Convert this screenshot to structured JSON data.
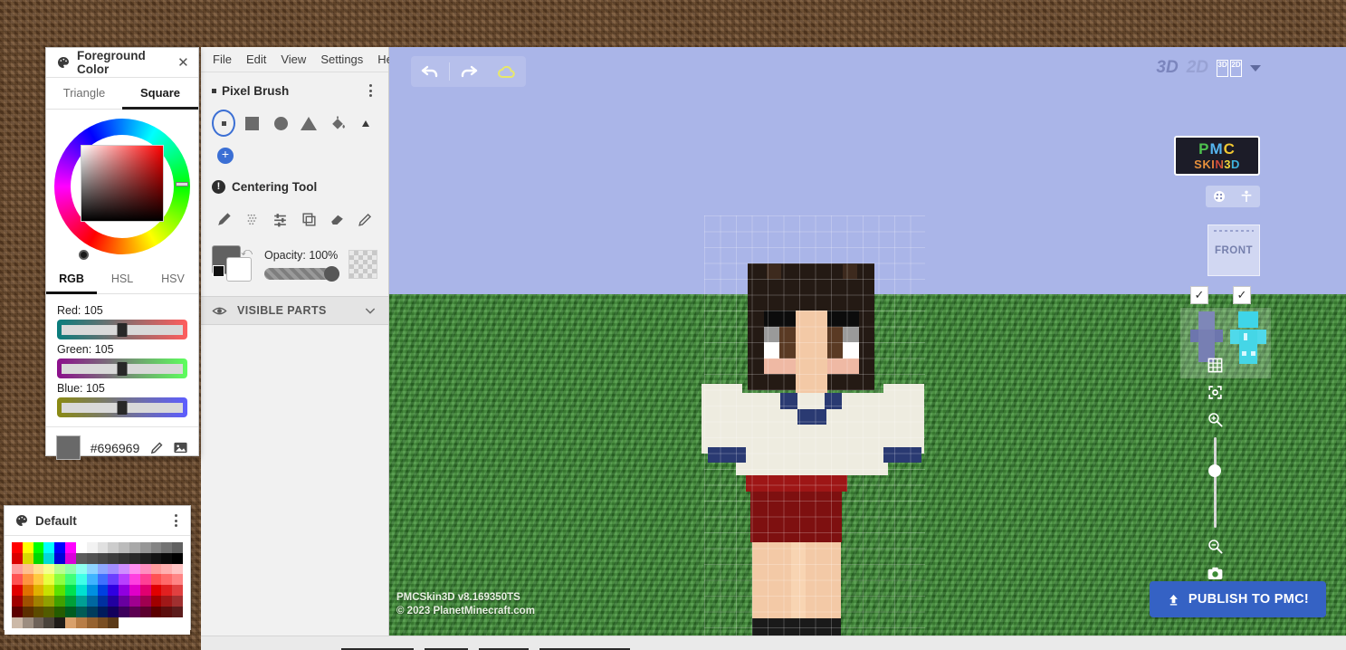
{
  "app": {
    "watermark_line1": "PMCSkin3D v8.169350TS",
    "watermark_line2": "© 2023 PlanetMinecraft.com",
    "logo_top": "PMC",
    "logo_bottom": "SKIN3D"
  },
  "menubar": {
    "items": [
      {
        "label": "File"
      },
      {
        "label": "Edit"
      },
      {
        "label": "View"
      },
      {
        "label": "Settings"
      },
      {
        "label": "Help"
      }
    ]
  },
  "foreground_color_panel": {
    "title": "Foreground Color",
    "icon": "palette-icon",
    "close_label": "✕",
    "shape_tabs": [
      {
        "label": "Triangle",
        "selected": false
      },
      {
        "label": "Square",
        "selected": true
      }
    ],
    "mode_tabs": [
      {
        "label": "RGB",
        "selected": true
      },
      {
        "label": "HSL",
        "selected": false
      },
      {
        "label": "HSV",
        "selected": false
      }
    ],
    "channels": [
      {
        "name": "Red",
        "label": "Red: 105",
        "value": 105
      },
      {
        "name": "Green",
        "label": "Green: 105",
        "value": 105
      },
      {
        "name": "Blue",
        "label": "Blue: 105",
        "value": 105
      }
    ],
    "hex": "#696969",
    "current_color": "#696969",
    "eyedropper_icon": "eyedropper-icon",
    "image_picker_icon": "image-icon"
  },
  "palette_panel": {
    "title": "Default",
    "icon": "palette-icon",
    "rows": [
      [
        "#ff0000",
        "#ffff00",
        "#00ff00",
        "#00ffff",
        "#0000ff",
        "#ff00ff",
        "#ffffff",
        "#f2f2f2",
        "#e0e0e0",
        "#cccccc",
        "#bbbbbb",
        "#a8a8a8",
        "#969696",
        "#848484",
        "#737373",
        "#616161"
      ],
      [
        "#d90000",
        "#d9d900",
        "#00d900",
        "#00d9d9",
        "#0000d9",
        "#d900d9",
        "#5c5c5c",
        "#525252",
        "#474747",
        "#3d3d3d",
        "#333333",
        "#292929",
        "#1f1f1f",
        "#141414",
        "#0a0a0a",
        "#000000"
      ],
      [
        "#ff9e9e",
        "#ffbf8f",
        "#ffe08f",
        "#f5ff8f",
        "#b8ff8f",
        "#8fffab",
        "#8ffff0",
        "#8fd4ff",
        "#8fa8ff",
        "#a38fff",
        "#cf8fff",
        "#ff8ff0",
        "#ff8fc0",
        "#ff9e9e",
        "#ffb0b0",
        "#ffc4c4"
      ],
      [
        "#ff5252",
        "#ff9440",
        "#ffc940",
        "#e8ff40",
        "#8cff40",
        "#40ff7a",
        "#40ffe8",
        "#40b4ff",
        "#4070ff",
        "#6b40ff",
        "#b840ff",
        "#ff40e0",
        "#ff4095",
        "#ff5252",
        "#ff6b6b",
        "#ff8585"
      ],
      [
        "#e00000",
        "#e07000",
        "#e0b000",
        "#c8e000",
        "#5ce000",
        "#00e050",
        "#00e0d0",
        "#0090e0",
        "#0040e0",
        "#3000e0",
        "#9000e0",
        "#e000c8",
        "#e00070",
        "#e00000",
        "#e02020",
        "#e04040"
      ],
      [
        "#a00000",
        "#a05000",
        "#a08000",
        "#90a000",
        "#40a000",
        "#00a038",
        "#00a095",
        "#0068a0",
        "#0030a0",
        "#2200a0",
        "#6800a0",
        "#a00090",
        "#a00050",
        "#a00000",
        "#a01818",
        "#a03030"
      ],
      [
        "#5c0000",
        "#5c2e00",
        "#5c4a00",
        "#525c00",
        "#255c00",
        "#005c20",
        "#005c56",
        "#003c5c",
        "#001b5c",
        "#13005c",
        "#3c005c",
        "#5c0052",
        "#5c002e",
        "#5c0000",
        "#5c0e0e",
        "#5c1c1c"
      ],
      [
        "#ccb9a8",
        "#9c8d80",
        "#6e6259",
        "#4a433c",
        "#1f1c19",
        "#d9a06b",
        "#b87d46",
        "#96622f",
        "#7a4e22",
        "#5c3a18",
        "#ffffff",
        "#ffffff",
        "#ffffff",
        "#ffffff",
        "#ffffff",
        "#ffffff"
      ]
    ]
  },
  "tools_panel": {
    "brush_section": {
      "name": "Pixel Brush",
      "shapes": [
        {
          "name": "dot-brush",
          "selected": true
        },
        {
          "name": "square-brush",
          "selected": false
        },
        {
          "name": "circle-brush",
          "selected": false
        },
        {
          "name": "triangle-brush",
          "selected": false
        },
        {
          "name": "fill-bucket",
          "selected": false
        },
        {
          "name": "tiny-brush",
          "selected": false
        }
      ],
      "add_label": "+",
      "kebab": "more-options-icon"
    },
    "centering_section": {
      "name": "Centering Tool",
      "warn_glyph": "!",
      "tools": [
        {
          "name": "pencil-tool"
        },
        {
          "name": "dither-tool"
        },
        {
          "name": "adjust-tool"
        },
        {
          "name": "layers-tool"
        },
        {
          "name": "eraser-tool"
        },
        {
          "name": "eyedropper-tool"
        }
      ]
    },
    "opacity": {
      "label": "Opacity: 100%",
      "value": 100,
      "foreground_swatch": "#616161",
      "background_swatch": "#ffffff"
    },
    "visible_parts": {
      "label": "VISIBLE PARTS",
      "eye_icon": "eye-icon",
      "chevron": "chevron-down-icon"
    }
  },
  "viewport": {
    "toolbar": [
      {
        "name": "undo-button",
        "glyph": "↶"
      },
      {
        "name": "redo-button",
        "glyph": "↷"
      },
      {
        "name": "cloud-save-button",
        "glyph": "☁"
      }
    ],
    "view_modes": {
      "three_d": "3D",
      "two_d": "2D",
      "split_left": "3D",
      "split_right": "2D"
    },
    "avatar_tools": [
      {
        "name": "skin-preview-icon"
      },
      {
        "name": "pose-icon"
      }
    ],
    "orientation_label": "FRONT",
    "layer_checkboxes": [
      {
        "name": "base-layer-checkbox",
        "checked": true,
        "glyph": "✓"
      },
      {
        "name": "overlay-layer-checkbox",
        "checked": true,
        "glyph": "✓"
      }
    ],
    "right_tools": [
      {
        "name": "grid-toggle-icon"
      },
      {
        "name": "center-view-icon"
      },
      {
        "name": "zoom-in-icon"
      },
      {
        "name": "zoom-out-icon"
      },
      {
        "name": "screenshot-icon"
      }
    ],
    "zoom_slider_value": 68,
    "publish_button": "PUBLISH TO PMC!",
    "publish_icon": "upload-icon",
    "sky_color": "#aab5e8",
    "ground_color": "#3d8b36"
  },
  "character": {
    "description": "Minecraft skin preview: dark-haired character in white sailor uniform with navy collar trim, dark red skirt, bare legs and black shoes",
    "colors": {
      "hair": "#241a14",
      "hair_light": "#3d2a1e",
      "skin": "#f3c9a6",
      "eye_white": "#ffffff",
      "eye_gray": "#9a9a9a",
      "eye_brown": "#5a3a24",
      "blush": "#efb9a4",
      "shirt": "#eeece0",
      "collar": "#2a3a72",
      "skirt": "#9e1616",
      "skirt_dark": "#7e1010",
      "shoes": "#1a1a1a"
    }
  }
}
